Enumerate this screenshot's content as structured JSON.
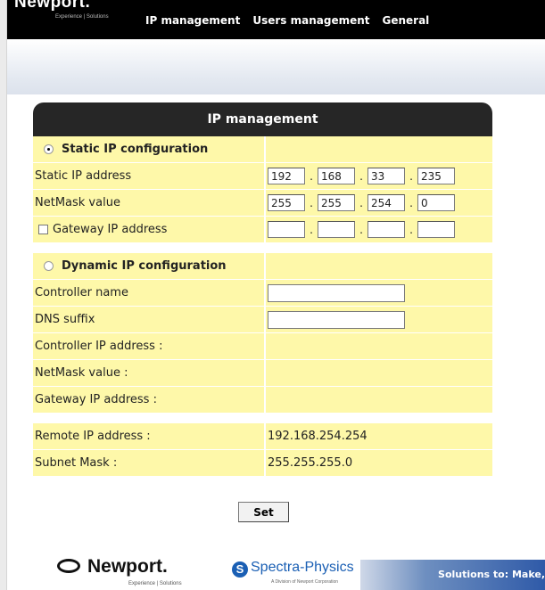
{
  "header": {
    "logo_text": "Newport.",
    "logo_tagline": "Experience | Solutions",
    "nav": [
      "IP management",
      "Users management",
      "General"
    ]
  },
  "panel": {
    "title": "IP management",
    "static": {
      "heading": "Static IP configuration",
      "selected": true,
      "ip_label": "Static IP address",
      "ip": [
        "192",
        "168",
        "33",
        "235"
      ],
      "netmask_label": "NetMask value",
      "netmask": [
        "255",
        "255",
        "254",
        "0"
      ],
      "gateway_label": "Gateway IP address",
      "gateway_checked": false,
      "gateway": [
        "",
        "",
        "",
        ""
      ]
    },
    "dynamic": {
      "heading": "Dynamic IP configuration",
      "selected": false,
      "controller_name_label": "Controller name",
      "controller_name": "",
      "dns_suffix_label": "DNS suffix",
      "dns_suffix": "",
      "controller_ip_label": "Controller IP address :",
      "netmask_label": "NetMask value :",
      "gateway_label": "Gateway IP address :"
    },
    "remote": {
      "remote_ip_label": "Remote IP address :",
      "remote_ip": "192.168.254.254",
      "subnet_mask_label": "Subnet Mask :",
      "subnet_mask": "255.255.255.0"
    },
    "set_label": "Set"
  },
  "footer": {
    "newport_logo": "Newport.",
    "newport_tagline": "Experience | Solutions",
    "spectra_logo": "Spectra-Physics",
    "spectra_tagline": "A Division of Newport Corporation",
    "banner": "Solutions to: Make,"
  },
  "colors": {
    "row_bg": "#fef8a9",
    "header_bg": "#000000",
    "panel_header_bg": "#262626"
  }
}
